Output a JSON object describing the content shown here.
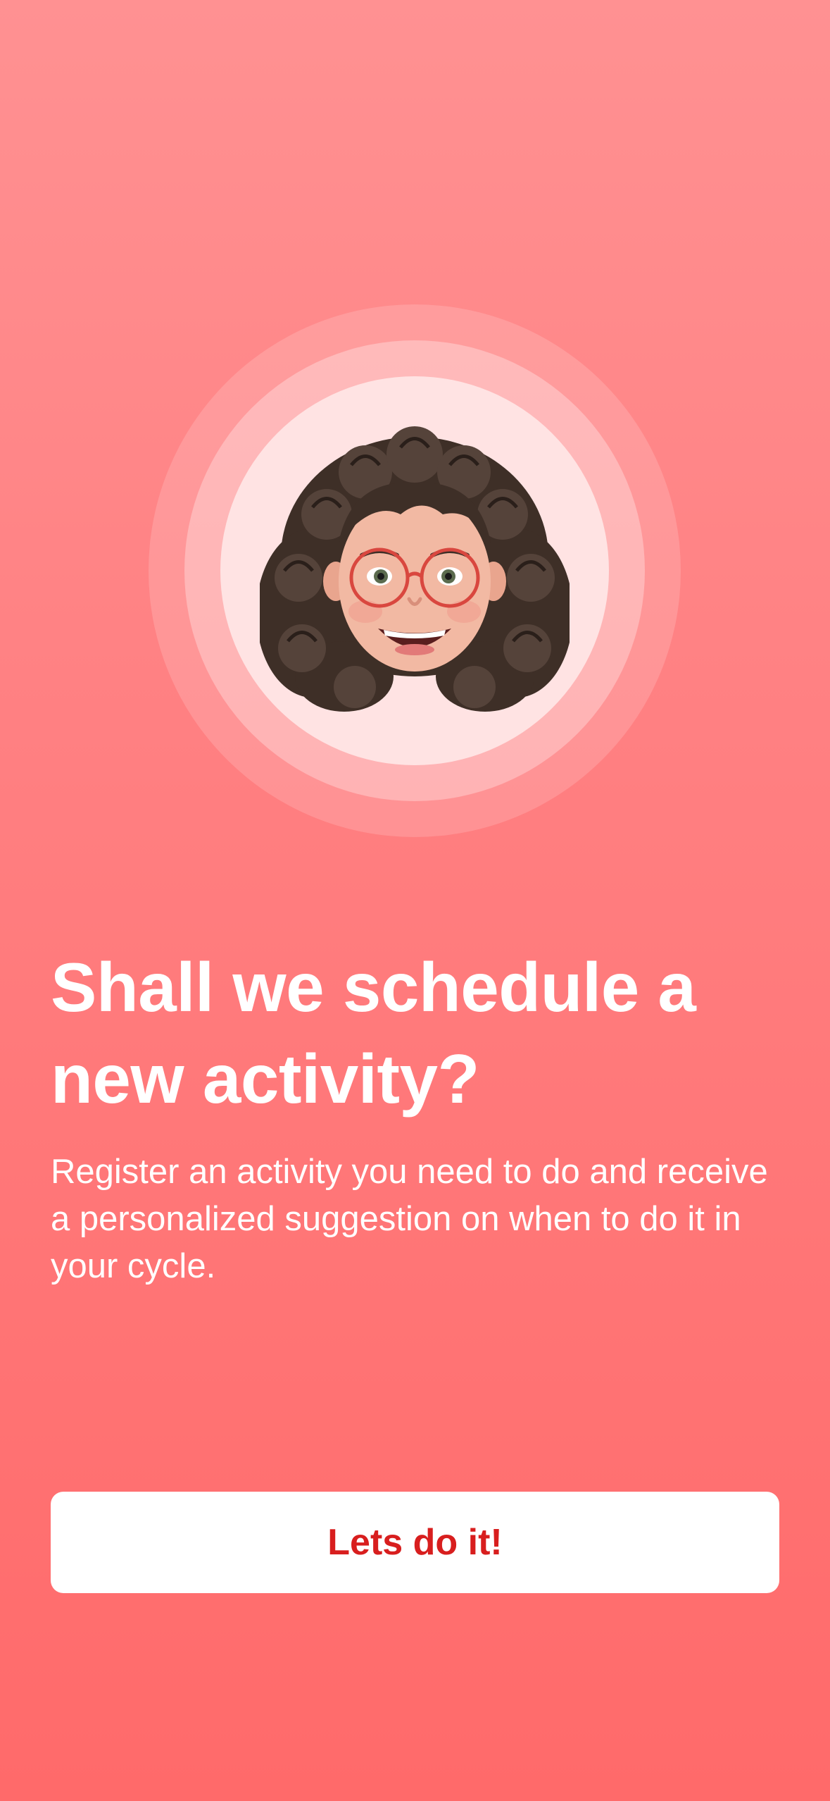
{
  "onboarding": {
    "avatar_icon": "memoji-curly-hair-glasses-avatar",
    "title": "Shall we schedule a new activity?",
    "description": "Register an activity you need to do and receive a personalized suggestion on when to do it in your cycle.",
    "cta_label": "Lets do it!"
  },
  "colors": {
    "background_top": "#FF9192",
    "background_bottom": "#FF6A6A",
    "inner_circle": "#FFE3E3",
    "button_background": "#FFFFFF",
    "button_text": "#D81E1E",
    "text": "#FFFFFF"
  }
}
